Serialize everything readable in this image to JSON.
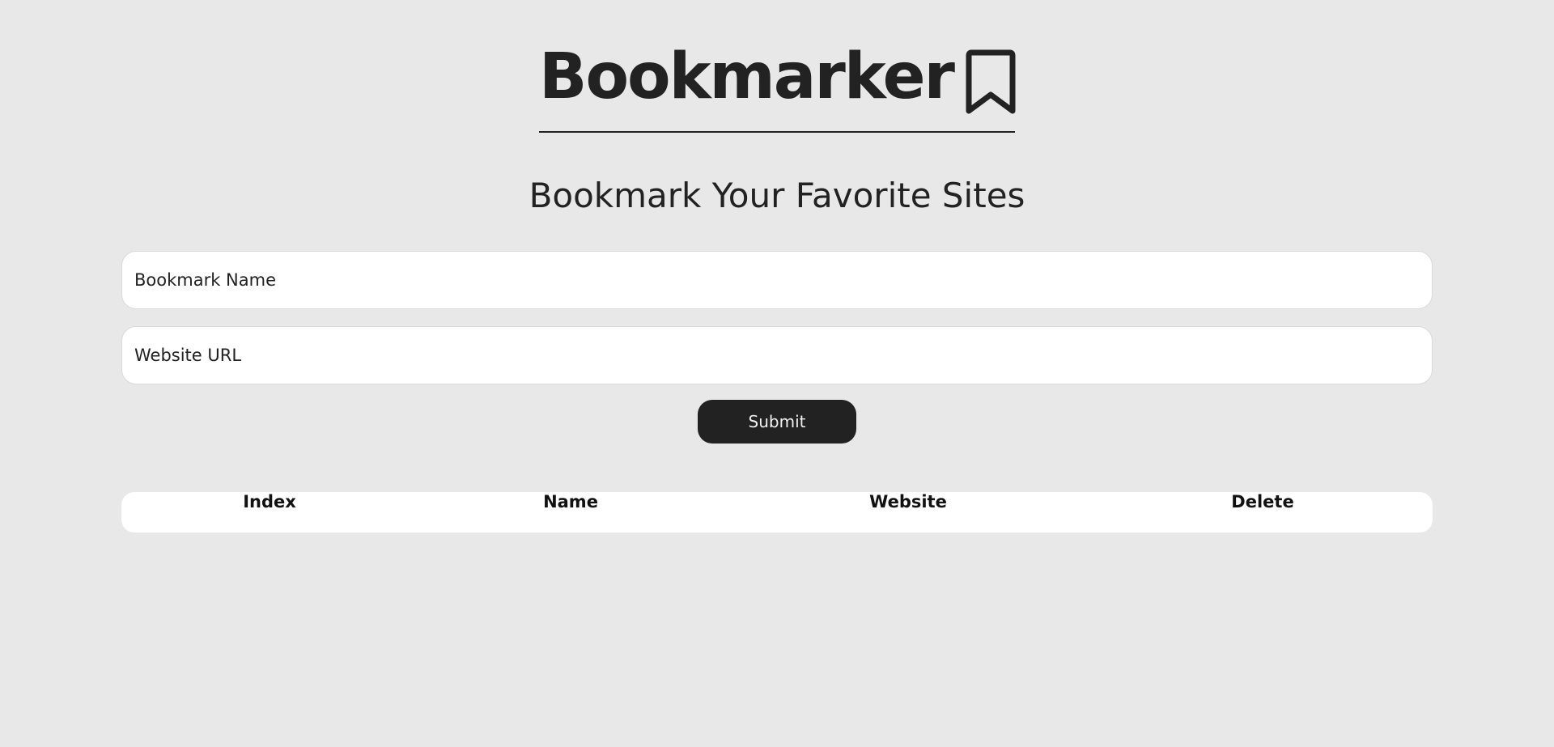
{
  "header": {
    "title": "Bookmarker",
    "icon": "bookmark-icon"
  },
  "form": {
    "heading": "Bookmark Your Favorite Sites",
    "name_placeholder": "Bookmark Name",
    "name_value": "",
    "url_placeholder": "Website URL",
    "url_value": "",
    "submit_label": "Submit"
  },
  "table": {
    "columns": [
      "Index",
      "Name",
      "Website",
      "Delete"
    ],
    "rows": []
  },
  "colors": {
    "background": "#e8e8e8",
    "primary": "#222222",
    "surface": "#ffffff",
    "button_text": "#f1f1f1"
  }
}
